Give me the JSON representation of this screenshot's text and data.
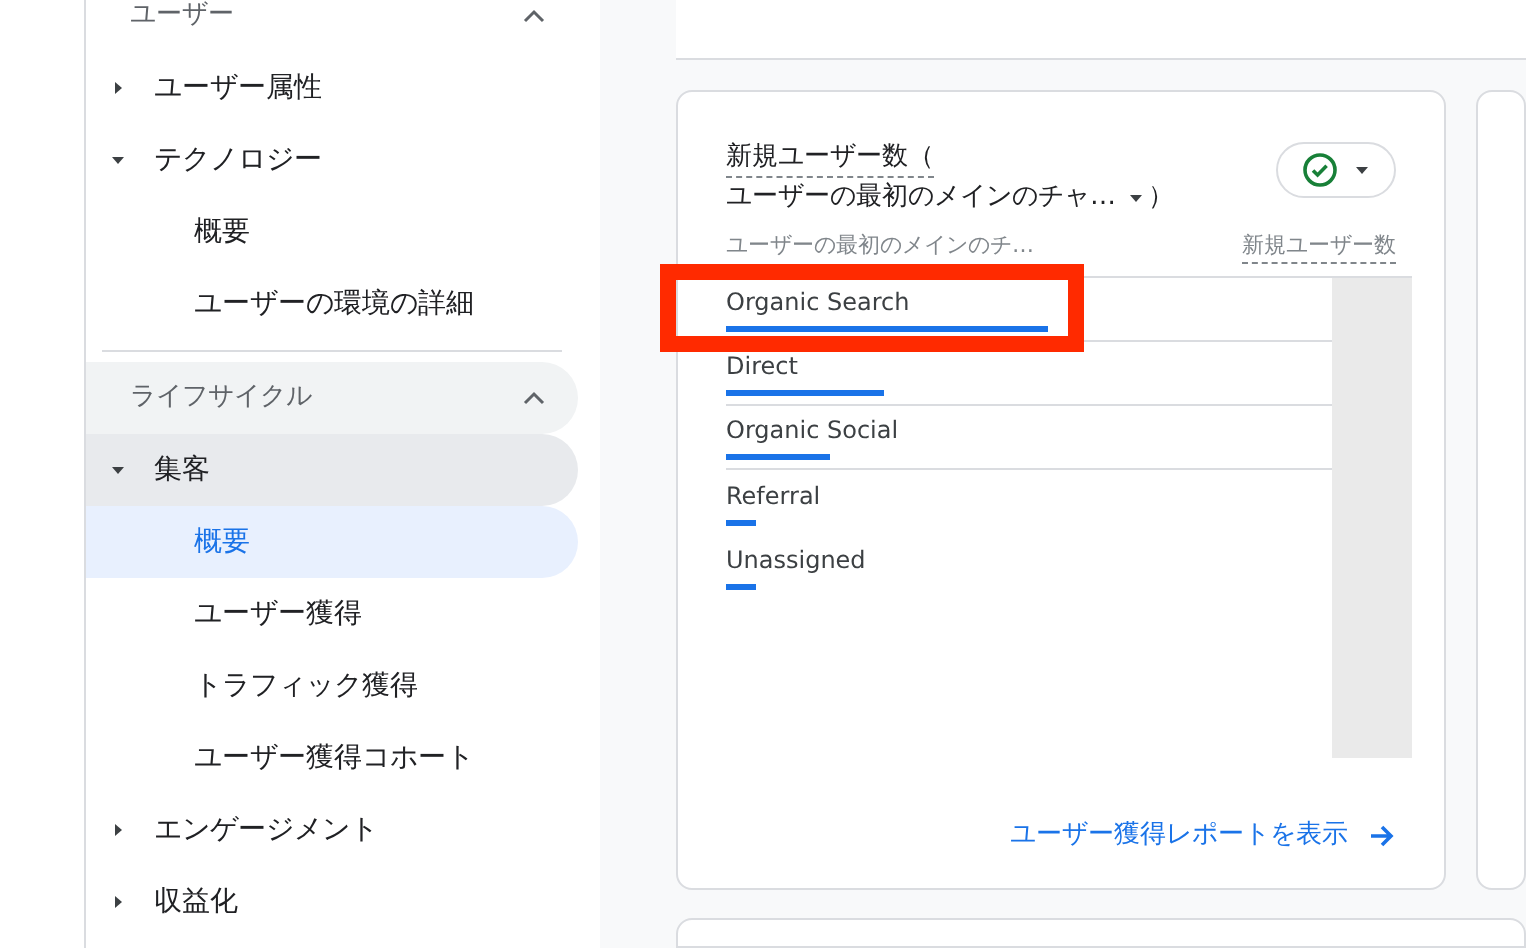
{
  "sidebar": {
    "sections": [
      {
        "title": "ユーザー",
        "expanded": true,
        "highlighted": false,
        "items": [
          {
            "label": "ユーザー属性",
            "expanded": false,
            "selected": false
          },
          {
            "label": "テクノロジー",
            "expanded": true,
            "selected": false,
            "children": [
              {
                "label": "概要",
                "selected": false
              },
              {
                "label": "ユーザーの環境の詳細",
                "selected": false
              }
            ]
          }
        ]
      },
      {
        "title": "ライフサイクル",
        "expanded": true,
        "highlighted": true,
        "items": [
          {
            "label": "集客",
            "expanded": true,
            "selected": true,
            "children": [
              {
                "label": "概要",
                "selected": true
              },
              {
                "label": "ユーザー獲得",
                "selected": false
              },
              {
                "label": "トラフィック獲得",
                "selected": false
              },
              {
                "label": "ユーザー獲得コホート",
                "selected": false
              }
            ]
          },
          {
            "label": "エンゲージメント",
            "expanded": false,
            "selected": false
          },
          {
            "label": "収益化",
            "expanded": false,
            "selected": false
          }
        ]
      }
    ]
  },
  "card": {
    "title": "新規ユーザー数（",
    "dimension": "ユーザーの最初のメインのチャ…",
    "close_paren": "）",
    "columns": [
      "ユーザーの最初のメインのチ…",
      "新規ユーザー数"
    ],
    "rows": [
      {
        "label": "Organic Search",
        "level": 0.53,
        "highlighted": true
      },
      {
        "label": "Direct",
        "level": 0.26,
        "highlighted": false
      },
      {
        "label": "Organic Social",
        "level": 0.17,
        "highlighted": false
      },
      {
        "label": "Referral",
        "level": 0.05,
        "highlighted": false
      },
      {
        "label": "Unassigned",
        "level": 0.05,
        "highlighted": false
      }
    ],
    "link": "ユーザー獲得レポートを表示"
  }
}
